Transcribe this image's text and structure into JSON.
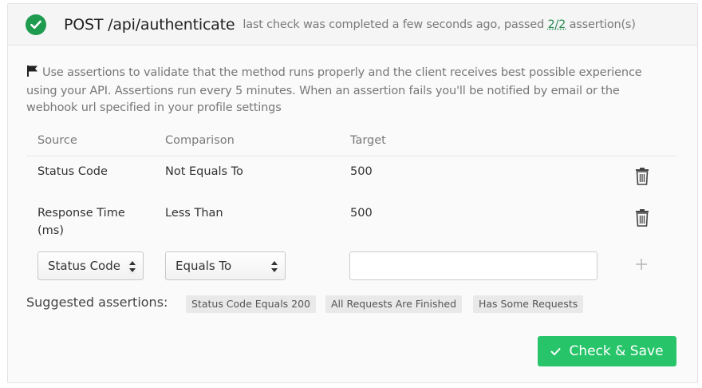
{
  "header": {
    "method_path": "POST /api/authenticate",
    "status_prefix": "last check was completed a few seconds ago, passed",
    "passed_count": "2/2",
    "status_suffix": "assertion(s)"
  },
  "description": "Use assertions to validate that the method runs properly and the client receives best possible experience using your API. Assertions run every 5 minutes. When an assertion fails you'll be notified by email or the webhook url specified in your profile settings",
  "columns": {
    "source": "Source",
    "comparison": "Comparison",
    "target": "Target"
  },
  "assertions": [
    {
      "source": "Status Code",
      "comparison": "Not Equals To",
      "target": "500"
    },
    {
      "source": "Response Time (ms)",
      "comparison": "Less Than",
      "target": "500"
    }
  ],
  "new_assertion": {
    "source_selected": "Status Code",
    "comparison_selected": "Equals To",
    "target_value": ""
  },
  "suggested": {
    "label": "Suggested assertions:",
    "chips": [
      "Status Code Equals 200",
      "All Requests Are Finished",
      "Has Some Requests"
    ]
  },
  "save_button": "Check & Save",
  "colors": {
    "success": "#1e9b4f",
    "button": "#27c46a",
    "link": "#2a8a55"
  },
  "icons": {
    "status": "check-circle-icon",
    "flag": "flag-icon",
    "delete": "trash-icon",
    "add": "plus-icon",
    "select": "updown-arrows-icon"
  }
}
